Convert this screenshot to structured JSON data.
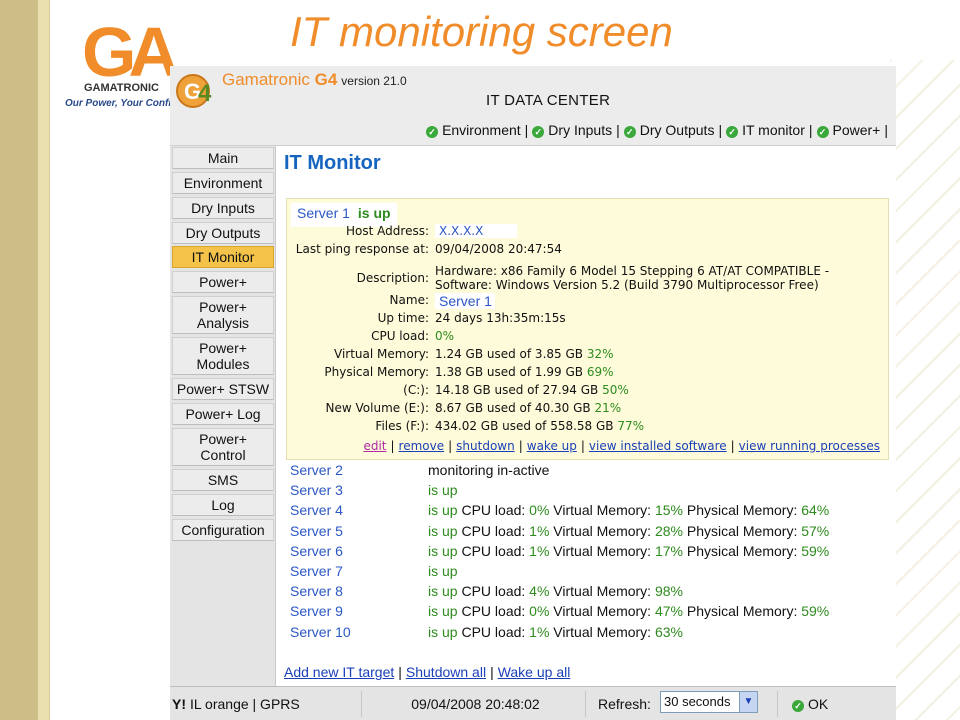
{
  "slide": {
    "title": "IT monitoring screen",
    "logo_letters": "GA",
    "logo_brand": "GAMATRONIC",
    "logo_tagline": "Our Power, Your Confide"
  },
  "app": {
    "name_light": "Gamatronic ",
    "name_bold": "G4",
    "version": "version 21.0",
    "center_title": "IT DATA CENTER",
    "topnav": [
      "Environment",
      "Dry Inputs",
      "Dry Outputs",
      "IT monitor",
      "Power+"
    ]
  },
  "sidebar": {
    "items": [
      {
        "label": "Main",
        "active": false
      },
      {
        "label": "Environment",
        "active": false
      },
      {
        "label": "Dry Inputs",
        "active": false
      },
      {
        "label": "Dry Outputs",
        "active": false
      },
      {
        "label": "IT Monitor",
        "active": true
      },
      {
        "label": "Power+",
        "active": false
      },
      {
        "label": "Power+ Analysis",
        "active": false
      },
      {
        "label": "Power+ Modules",
        "active": false
      },
      {
        "label": "Power+ STSW",
        "active": false
      },
      {
        "label": "Power+ Log",
        "active": false
      },
      {
        "label": "Power+ Control",
        "active": false
      },
      {
        "label": "SMS",
        "active": false
      },
      {
        "label": "Log",
        "active": false
      },
      {
        "label": "Configuration",
        "active": false
      }
    ]
  },
  "main": {
    "title": "IT Monitor",
    "detail": {
      "server_name": "Server 1",
      "status": "is up",
      "rows": [
        {
          "label": "Host Address:",
          "value": "X.X.X.X"
        },
        {
          "label": "Last ping response at:",
          "value": "09/04/2008 20:47:54"
        },
        {
          "label": "Description:",
          "value": "Hardware: x86 Family 6 Model 15 Stepping 6 AT/AT COMPATIBLE -",
          "value2": "Software: Windows Version 5.2 (Build 3790 Multiprocessor Free)"
        },
        {
          "label": "Name:",
          "value": "Server 1"
        },
        {
          "label": "Up time:",
          "value": "24 days 13h:35m:15s"
        },
        {
          "label": "CPU load:",
          "value": "",
          "pct": "0%"
        },
        {
          "label": "Virtual Memory:",
          "value": "1.24 GB used of 3.85 GB ",
          "pct": "32%"
        },
        {
          "label": "Physical Memory:",
          "value": "1.38 GB used of 1.99 GB ",
          "pct": "69%"
        },
        {
          "label": "(C:):",
          "value": "14.18 GB used of 27.94 GB ",
          "pct": "50%"
        },
        {
          "label": "New Volume (E:):",
          "value": "8.67 GB used of 40.30 GB ",
          "pct": "21%"
        },
        {
          "label": "Files (F:):",
          "value": "434.02 GB used of 558.58 GB ",
          "pct": "77%"
        }
      ],
      "links": [
        "edit",
        "remove",
        "shutdown",
        "wake up",
        "view installed software",
        "view running processes"
      ]
    },
    "servers": [
      {
        "name": "Server 2",
        "status": "monitoring in-active",
        "cpu": null,
        "vm": null,
        "pm": null
      },
      {
        "name": "Server 3",
        "status": "is up",
        "cpu": null,
        "vm": null,
        "pm": null
      },
      {
        "name": "Server 4",
        "status": "is up",
        "cpu": "0%",
        "vm": "15%",
        "pm": "64%"
      },
      {
        "name": "Server 5",
        "status": "is up",
        "cpu": "1%",
        "vm": "28%",
        "pm": "57%"
      },
      {
        "name": "Server 6",
        "status": "is up",
        "cpu": "1%",
        "vm": "17%",
        "pm": "59%"
      },
      {
        "name": "Server 7",
        "status": "is up",
        "cpu": null,
        "vm": null,
        "pm": null
      },
      {
        "name": "Server 8",
        "status": "is up",
        "cpu": "4%",
        "vm": "98%",
        "pm": null
      },
      {
        "name": "Server 9",
        "status": "is up",
        "cpu": "0%",
        "vm": "47%",
        "pm": "59%"
      },
      {
        "name": "Server 10",
        "status": "is up",
        "cpu": "1%",
        "vm": "63%",
        "pm": null
      }
    ],
    "labels": {
      "cpu": "CPU load: ",
      "vm": "Virtual Memory: ",
      "pm": "Physical Memory: "
    },
    "bottom_links": [
      "Add new IT target",
      "Shutdown all",
      "Wake up all"
    ]
  },
  "statusbar": {
    "network": "IL orange | GPRS",
    "datetime": "09/04/2008 20:48:02",
    "refresh_label": "Refresh:",
    "refresh_value": "30 seconds",
    "status": "OK"
  },
  "colors": {
    "accent": "#f08c2a",
    "active_nav": "#f5c34a",
    "ok_green": "#3aa83a",
    "link_blue": "#2b57c4"
  }
}
